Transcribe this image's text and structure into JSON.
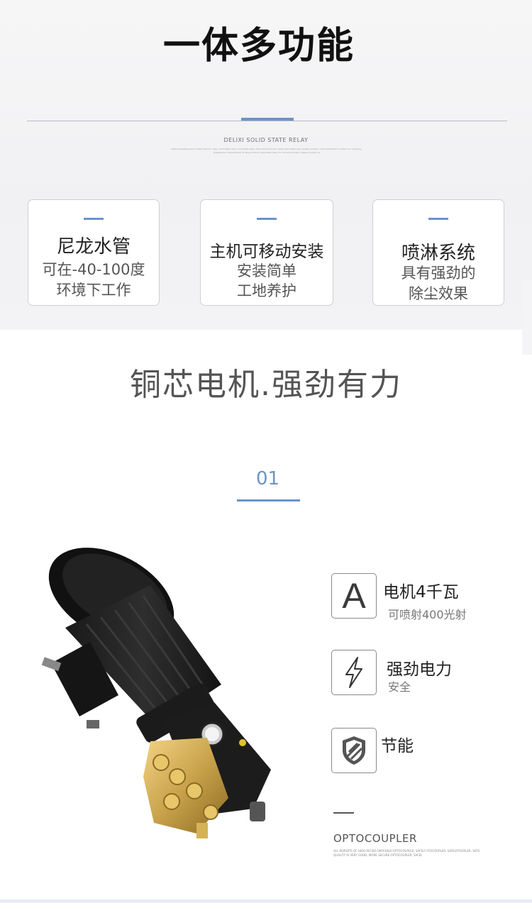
{
  "hero": {
    "title": "一体多功能",
    "relay_label": "DELIXI SOLID STATE RELAY",
    "relay_desc": "Delixi is leading brand, Delixi electric, relay, solid state relay, solid state relay, delixi electric brand, delixi solid state relay quality product, more information contact our company, professional manufacturer of relay product, solid state relay, for more information please contact us"
  },
  "cards": [
    {
      "title": "尼龙水管",
      "lines": [
        "可在-40-100度",
        "环境下工作"
      ]
    },
    {
      "title": "主机可移动安装",
      "lines": [
        "安装简单",
        "工地养护"
      ]
    },
    {
      "title": "喷淋系统",
      "lines": [
        "具有强劲的",
        "除尘效果"
      ]
    }
  ],
  "section": {
    "title": "铜芯电机.强劲有力",
    "number": "01"
  },
  "features": [
    {
      "icon": "letter-a-icon",
      "icon_text": "A",
      "title": "电机4千瓦",
      "subtitle": "可喷射400光射"
    },
    {
      "icon": "lightning-icon",
      "title": "强劲电力",
      "subtitle": "安全"
    },
    {
      "icon": "shield-icon",
      "title": "节能",
      "subtitle": ""
    }
  ],
  "optocoupler": {
    "label": "OPTOCOUPLER",
    "desc": "ALL REPORTS OF HIGH RECKD FAIRCHILD OPTOCOUPLER, SAFELY FFOCOUPLER, SAFELYFOURLER, SAFE QUALITY IS VERY GOOD, MORE SECURE OPTOCOUPLER, SAFEL"
  },
  "colors": {
    "accent": "#6a93c9",
    "title": "#111111",
    "subtitle_gray": "#545454"
  }
}
